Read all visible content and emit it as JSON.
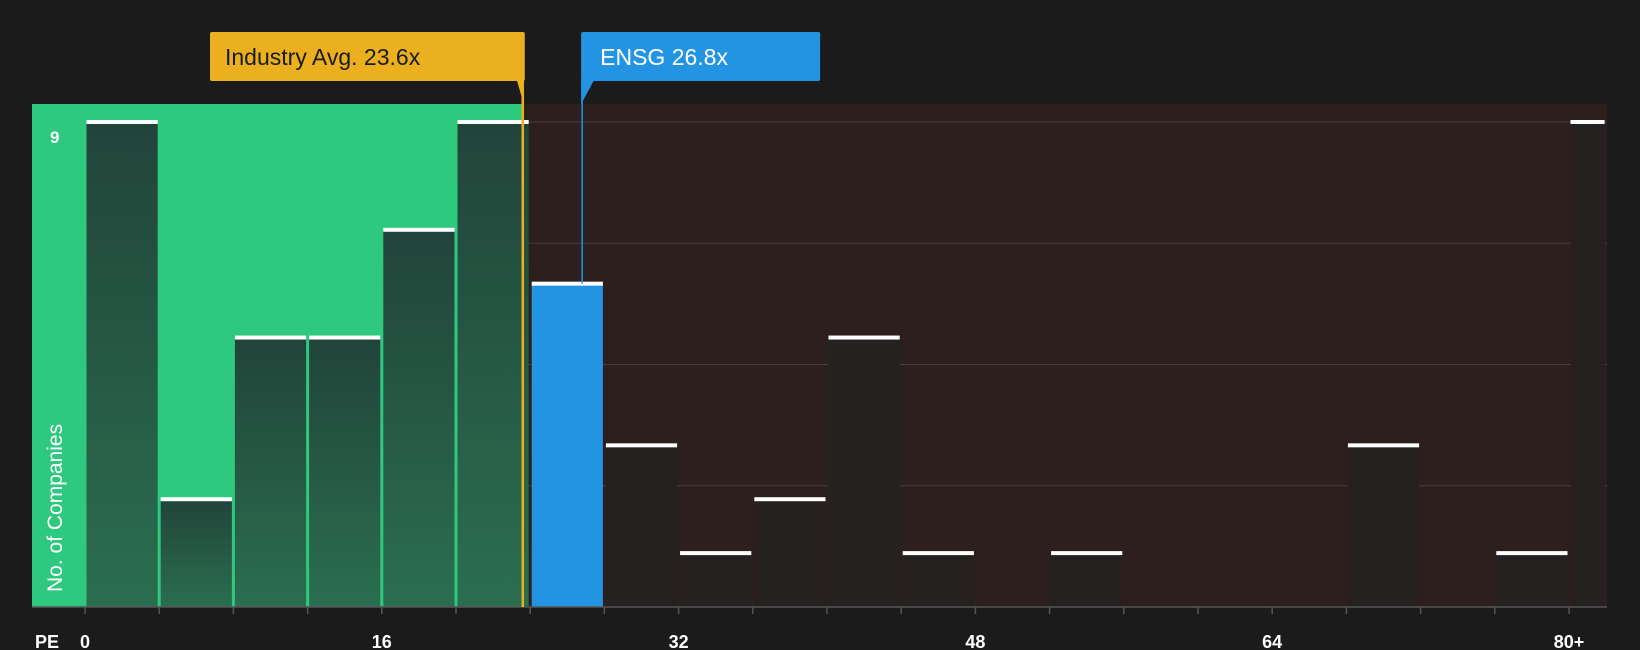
{
  "chart_data": {
    "type": "bar",
    "title": "",
    "xlabel": "PE",
    "ylabel": "No. of Companies",
    "ylim": [
      0,
      9
    ],
    "y_max_label": "9",
    "x_ticks": [
      "0",
      "16",
      "32",
      "48",
      "64",
      "80+"
    ],
    "x_tick_values": [
      0,
      16,
      32,
      48,
      64,
      80
    ],
    "x_range": [
      0,
      82
    ],
    "bin_width": 4,
    "bins": [
      {
        "start": 0,
        "end": 4,
        "count": 9
      },
      {
        "start": 4,
        "end": 8,
        "count": 2
      },
      {
        "start": 8,
        "end": 12,
        "count": 5
      },
      {
        "start": 12,
        "end": 16,
        "count": 5
      },
      {
        "start": 16,
        "end": 20,
        "count": 7
      },
      {
        "start": 20,
        "end": 24,
        "count": 9
      },
      {
        "start": 24,
        "end": 28,
        "count": 6,
        "highlight": true
      },
      {
        "start": 28,
        "end": 32,
        "count": 3
      },
      {
        "start": 32,
        "end": 36,
        "count": 1
      },
      {
        "start": 36,
        "end": 40,
        "count": 2
      },
      {
        "start": 40,
        "end": 44,
        "count": 5
      },
      {
        "start": 44,
        "end": 48,
        "count": 1
      },
      {
        "start": 48,
        "end": 52,
        "count": 0
      },
      {
        "start": 52,
        "end": 56,
        "count": 1
      },
      {
        "start": 56,
        "end": 60,
        "count": 0
      },
      {
        "start": 60,
        "end": 64,
        "count": 0
      },
      {
        "start": 64,
        "end": 68,
        "count": 0
      },
      {
        "start": 68,
        "end": 72,
        "count": 3
      },
      {
        "start": 72,
        "end": 76,
        "count": 0
      },
      {
        "start": 76,
        "end": 80,
        "count": 1
      },
      {
        "start": 80,
        "end": 82,
        "count": 9
      }
    ],
    "industry_avg": {
      "value": 23.6,
      "label": "Industry Avg. 23.6x"
    },
    "company": {
      "ticker": "ENSG",
      "value": 26.8,
      "label": "ENSG 26.8x"
    },
    "colors": {
      "background": "#1b1b1b",
      "undervalued_zone": "#2ec97e",
      "overvalued_zone": "#2e1f1f",
      "bar_green_zone_top": "#21443a",
      "bar_green_zone_bottom": "#2b6e4f",
      "bar_dark": "#252121",
      "highlight_bar": "#2394e2",
      "industry_marker": "#eab020",
      "company_marker": "#2394e2",
      "cap": "#ffffff",
      "text": "#ffffff",
      "grid": "#4a3c3c",
      "axis": "#555555"
    },
    "grid": true,
    "legend": "none"
  }
}
